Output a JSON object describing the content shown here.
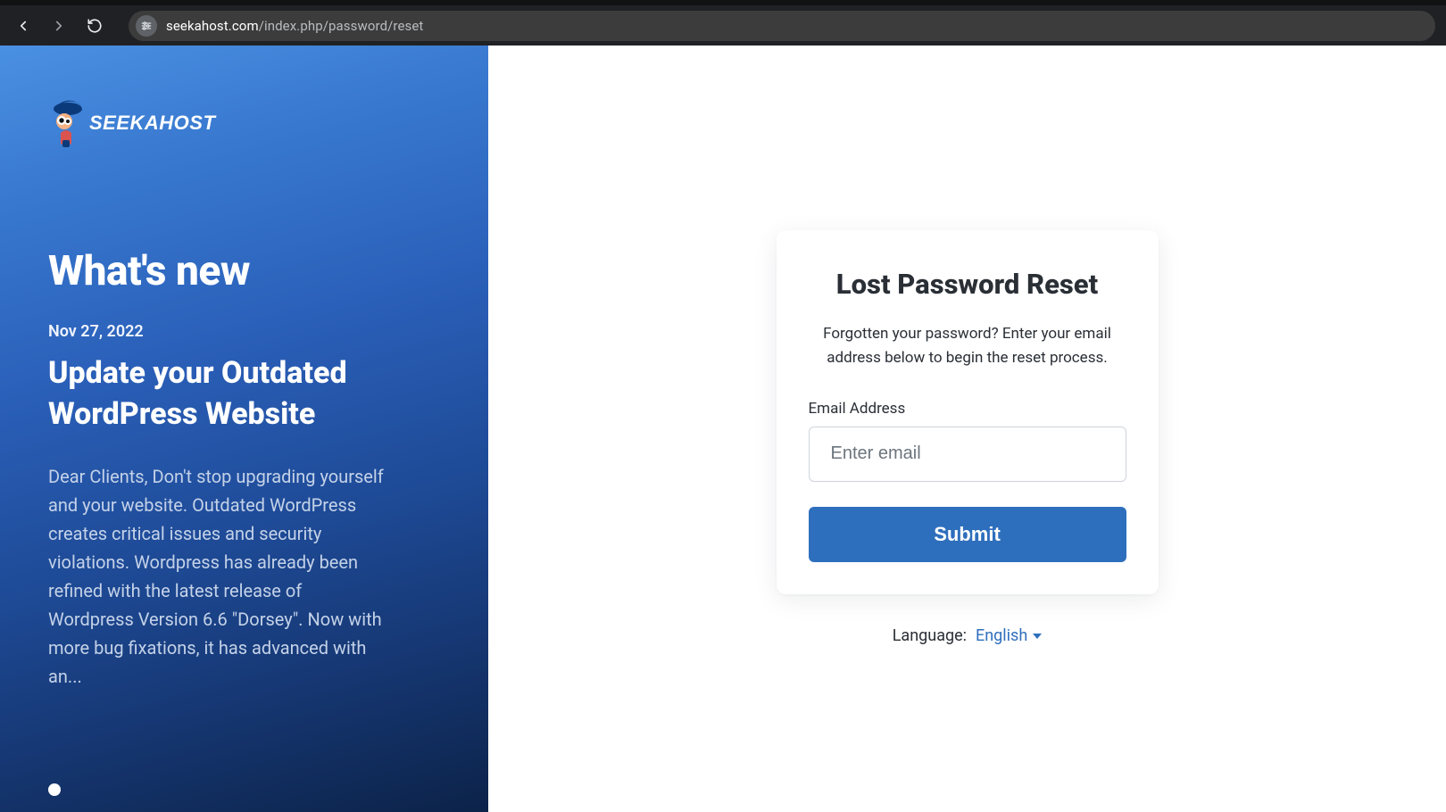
{
  "browser": {
    "url_domain": "seekahost.com",
    "url_path": "/index.php/password/reset"
  },
  "brand": {
    "name": "SEEKAHOST"
  },
  "left": {
    "heading": "What's new",
    "news": {
      "date": "Nov 27, 2022",
      "title": "Update your Outdated WordPress Website",
      "body": "Dear Clients, Don't stop upgrading yourself and your website. Outdated WordPress creates critical issues and security violations. Wordpress has already been refined with the latest release of Wordpress Version 6.6 \"Dorsey\". Now with more bug fixations, it has advanced with an..."
    }
  },
  "form": {
    "title": "Lost Password Reset",
    "subtitle": "Forgotten your password? Enter your email address below to begin the reset process.",
    "email_label": "Email Address",
    "email_placeholder": "Enter email",
    "submit_label": "Submit"
  },
  "language": {
    "label": "Language:",
    "selected": "English"
  }
}
